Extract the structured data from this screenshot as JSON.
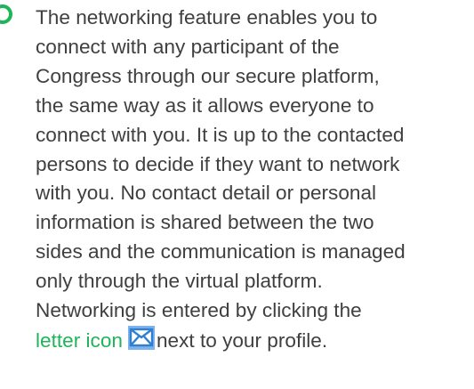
{
  "lines": [
    "The networking feature enables you to",
    "connect with any participant of the",
    "Congress through our secure platform,",
    "the same way as it allows everyone to",
    "connect with you. It is up to the contacted",
    "persons to decide if they want to network",
    "with you. No contact detail or personal",
    "information is shared between the two",
    "sides and the communication is managed",
    "only through the virtual platform.",
    "Networking is entered by clicking the"
  ],
  "last_line": {
    "link_text": "letter icon",
    "after_text": "next to your profile."
  },
  "icons": {
    "bullet": "circle-bullet-icon",
    "letter": "envelope-icon"
  },
  "colors": {
    "text": "#3f3f3f",
    "accent_green": "#1fb45a",
    "icon_blue": "#2f7fd3",
    "icon_bg": "#7db3ea"
  }
}
